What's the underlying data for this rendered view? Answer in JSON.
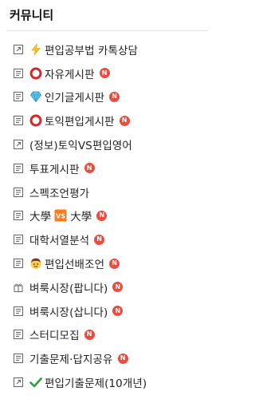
{
  "panel": {
    "title": "커뮤니티"
  },
  "new_badge": "N",
  "items": [
    {
      "label": "편입공부법 카톡상담"
    },
    {
      "label": "자유게시판"
    },
    {
      "label": "인기글게시판"
    },
    {
      "label": "토익편입게시판"
    },
    {
      "label": "(정보)토익VS편입영어"
    },
    {
      "label": "투표게시판"
    },
    {
      "label": "스펙조언평가"
    },
    {
      "label_left": "大學",
      "label_mid": "VS",
      "label_right": "大學"
    },
    {
      "label": "대학서열분석"
    },
    {
      "label": "편입선배조언"
    },
    {
      "label": "벼룩시장(팝니다)"
    },
    {
      "label": "벼룩시장(삽니다)"
    },
    {
      "label": "스터디모집"
    },
    {
      "label": "기출문제·답지공유"
    },
    {
      "label": "편입기출문제(10개년)"
    }
  ],
  "colors": {
    "new_badge": "#ee4b3e",
    "vs_badge": "#ff7a1a"
  }
}
